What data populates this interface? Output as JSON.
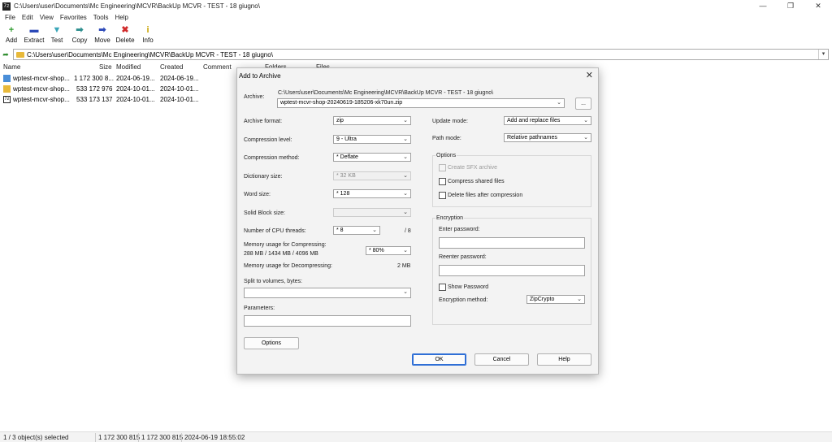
{
  "window": {
    "title": "C:\\Users\\user\\Documents\\Mc Engineering\\MCVR\\BackUp MCVR - TEST - 18 giugno\\",
    "app_icon_text": "7z"
  },
  "menu": [
    "File",
    "Edit",
    "View",
    "Favorites",
    "Tools",
    "Help"
  ],
  "toolbar": [
    {
      "label": "Add",
      "icon": "plus-icon",
      "glyph": "+",
      "color": "#2e9b2e"
    },
    {
      "label": "Extract",
      "icon": "minus-icon",
      "glyph": "▬",
      "color": "#2c49b8"
    },
    {
      "label": "Test",
      "icon": "test-icon",
      "glyph": "▼",
      "color": "#3aa6b9"
    },
    {
      "label": "Copy",
      "icon": "copy-icon",
      "glyph": "➡",
      "color": "#2f8f8f"
    },
    {
      "label": "Move",
      "icon": "move-icon",
      "glyph": "➡",
      "color": "#2c49b8"
    },
    {
      "label": "Delete",
      "icon": "delete-icon",
      "glyph": "✖",
      "color": "#d12b2b"
    },
    {
      "label": "Info",
      "icon": "info-icon",
      "glyph": "i",
      "color": "#c9a400"
    }
  ],
  "address": "C:\\Users\\user\\Documents\\Mc Engineering\\MCVR\\BackUp MCVR - TEST - 18 giugno\\",
  "filelist": {
    "columns": [
      "Name",
      "Size",
      "Modified",
      "Created",
      "Comment",
      "Folders",
      "Files"
    ],
    "rows": [
      {
        "name": "wptest-mcvr-shop...",
        "size": "1 172 300 8...",
        "modified": "2024-06-19...",
        "created": "2024-06-19...",
        "type": "doc"
      },
      {
        "name": "wptest-mcvr-shop...",
        "size": "533 172 976",
        "modified": "2024-10-01...",
        "created": "2024-10-01...",
        "type": "fold"
      },
      {
        "name": "wptest-mcvr-shop...",
        "size": "533 173 137",
        "modified": "2024-10-01...",
        "created": "2024-10-01...",
        "type": "arc"
      }
    ]
  },
  "statusbar": {
    "selected": "1 / 3 object(s) selected",
    "size1": "1 172 300 815",
    "size2": "1 172 300 815",
    "date": "2024-06-19 18:55:02"
  },
  "dialog": {
    "title": "Add to Archive",
    "archive_label": "Archive:",
    "archive_path": "C:\\Users\\user\\Documents\\Mc Engineering\\MCVR\\BackUp MCVR - TEST - 18 giugno\\",
    "archive_name": "wptest-mcvr-shop-20240619-185206-xk70un.zip",
    "browse_label": "...",
    "format_label": "Archive format:",
    "format_value": "zip",
    "level_label": "Compression level:",
    "level_value": "9 - Ultra",
    "method_label": "Compression method:",
    "method_value": "* Deflate",
    "dict_label": "Dictionary size:",
    "dict_value": "* 32 KB",
    "word_label": "Word size:",
    "word_value": "* 128",
    "solid_label": "Solid Block size:",
    "solid_value": "",
    "threads_label": "Number of CPU threads:",
    "threads_value": "* 8",
    "threads_max": "/ 8",
    "mem_comp_label": "Memory usage for Compressing:",
    "mem_comp_detail": "288 MB / 1434 MB / 4096 MB",
    "mem_comp_value": "* 80%",
    "mem_decomp_label": "Memory usage for Decompressing:",
    "mem_decomp_value": "2 MB",
    "split_label": "Split to volumes, bytes:",
    "params_label": "Parameters:",
    "options_btn": "Options",
    "update_label": "Update mode:",
    "update_value": "Add and replace files",
    "path_label": "Path mode:",
    "path_value": "Relative pathnames",
    "options_group": "Options",
    "opt_sfx": "Create SFX archive",
    "opt_shared": "Compress shared files",
    "opt_delete": "Delete files after compression",
    "enc_group": "Encryption",
    "enter_pw_label": "Enter password:",
    "reenter_pw_label": "Reenter password:",
    "show_pw_label": "Show Password",
    "enc_method_label": "Encryption method:",
    "enc_method_value": "ZipCrypto",
    "ok_btn": "OK",
    "cancel_btn": "Cancel",
    "help_btn": "Help"
  }
}
